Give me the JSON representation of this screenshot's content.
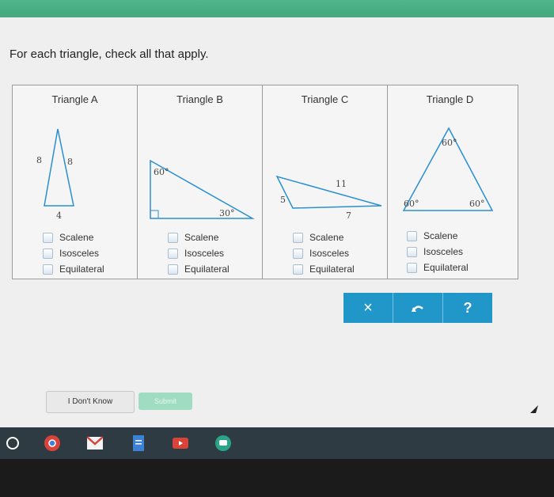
{
  "prompt": "For each triangle, check all that apply.",
  "triangles": [
    {
      "title": "Triangle A",
      "labels": [
        "8",
        "8",
        "4"
      ],
      "options": [
        "Scalene",
        "Isosceles",
        "Equilateral"
      ]
    },
    {
      "title": "Triangle B",
      "labels": [
        "60°",
        "30°"
      ],
      "options": [
        "Scalene",
        "Isosceles",
        "Equilateral"
      ]
    },
    {
      "title": "Triangle C",
      "labels": [
        "11",
        "5",
        "7"
      ],
      "options": [
        "Scalene",
        "Isosceles",
        "Equilateral"
      ]
    },
    {
      "title": "Triangle D",
      "labels": [
        "60°",
        "60°",
        "60°"
      ],
      "options": [
        "Scalene",
        "Isosceles",
        "Equilateral"
      ]
    }
  ],
  "toolbar": {
    "clear_icon": "×",
    "undo_icon": "undo-icon",
    "help_icon": "?"
  },
  "buttons": {
    "dont_know": "I Don't Know",
    "submit": "Submit"
  },
  "colors": {
    "accent": "#2196c9",
    "submit": "#9fdcc2",
    "topstrip": "#4fb58a"
  }
}
